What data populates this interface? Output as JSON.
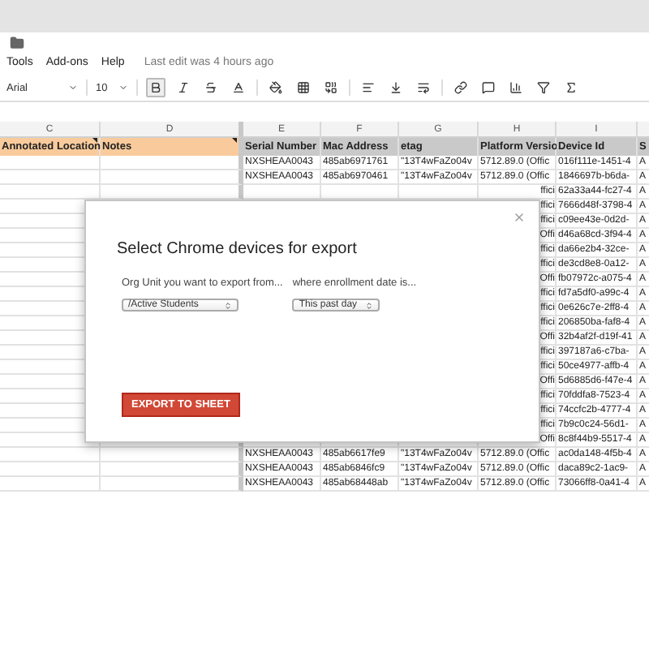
{
  "menu": [
    "Tools",
    "Add-ons",
    "Help"
  ],
  "last_edit": "Last edit was 4 hours ago",
  "toolbar": {
    "font": "Arial",
    "size": "10",
    "bold_pressed": true
  },
  "columns": [
    {
      "letter": "C",
      "header": "Annotated Location",
      "highlight": true
    },
    {
      "letter": "D",
      "header": "Notes",
      "highlight": true
    },
    {
      "letter": "E",
      "header": "Serial Number",
      "highlight": false
    },
    {
      "letter": "F",
      "header": "Mac Address",
      "highlight": false
    },
    {
      "letter": "G",
      "header": "etag",
      "highlight": false
    },
    {
      "letter": "H",
      "header": "Platform Versio",
      "highlight": false
    },
    {
      "letter": "I",
      "header": "Device Id",
      "highlight": false
    },
    {
      "header": "S",
      "highlight": false
    }
  ],
  "rows": [
    {
      "kind": "full",
      "e": "NXSHEAA0043",
      "f": "485ab6971761",
      "g": "\"13T4wFaZo04v",
      "h": "5712.89.0 (Offic",
      "i": "016f111e-1451-4",
      "j": "A"
    },
    {
      "kind": "full",
      "e": "NXSHEAA0043",
      "f": "485ab6970461",
      "g": "\"13T4wFaZo04v",
      "h": "5712.89.0 (Offic",
      "i": "1846697b-b6da-",
      "j": "A"
    },
    {
      "kind": "partial",
      "h": "ffici",
      "i": "62a33a44-fc27-4",
      "j": "A"
    },
    {
      "kind": "covered",
      "h": "ffici",
      "i": "7666d48f-3798-4",
      "j": "A"
    },
    {
      "kind": "covered",
      "h": "ffici",
      "i": "c09ee43e-0d2d-",
      "j": "A"
    },
    {
      "kind": "covered",
      "h": "Offi",
      "i": "d46a68cd-3f94-4",
      "j": "A"
    },
    {
      "kind": "covered",
      "h": "ffici",
      "i": "da66e2b4-32ce-",
      "j": "A"
    },
    {
      "kind": "covered",
      "h": "ffici",
      "i": "de3cd8e8-0a12-",
      "j": "A"
    },
    {
      "kind": "covered",
      "h": "Offi",
      "i": "fb07972c-a075-4",
      "j": "A"
    },
    {
      "kind": "covered",
      "h": "ffici",
      "i": "fd7a5df0-a99c-4",
      "j": "A"
    },
    {
      "kind": "covered",
      "h": "ffici",
      "i": "0e626c7e-2ff8-4",
      "j": "A"
    },
    {
      "kind": "covered",
      "h": "ffici",
      "i": "206850ba-faf8-4",
      "j": "A"
    },
    {
      "kind": "covered",
      "h": "Offi",
      "i": "32b4af2f-d19f-41",
      "j": "A"
    },
    {
      "kind": "covered",
      "h": "ffici",
      "i": "397187a6-c7ba-",
      "j": "A"
    },
    {
      "kind": "covered",
      "h": "ffici",
      "i": "50ce4977-affb-4",
      "j": "A"
    },
    {
      "kind": "covered",
      "h": "Offi",
      "i": "5d6885d6-f47e-4",
      "j": "A"
    },
    {
      "kind": "covered",
      "h": "ffici",
      "i": "70fddfa8-7523-4",
      "j": "A"
    },
    {
      "kind": "covered",
      "h": "ffici",
      "i": "74ccfc2b-4777-4",
      "j": "A"
    },
    {
      "kind": "covered",
      "h": "ffici",
      "i": "7b9c0c24-56d1-",
      "j": "A"
    },
    {
      "kind": "covered",
      "h": "Offi",
      "i": "8c8f44b9-5517-4",
      "j": "A"
    },
    {
      "kind": "full",
      "e": "NXSHEAA0043",
      "f": "485ab6617fe9",
      "g": "\"13T4wFaZo04v",
      "h": "5712.89.0 (Offic",
      "i": "ac0da148-4f5b-4",
      "j": "A"
    },
    {
      "kind": "full",
      "e": "NXSHEAA0043",
      "f": "485ab6846fc9",
      "g": "\"13T4wFaZo04v",
      "h": "5712.89.0 (Offic",
      "i": "daca89c2-1ac9-",
      "j": "A"
    },
    {
      "kind": "full",
      "e": "NXSHEAA0043",
      "f": "485ab68448ab",
      "g": "\"13T4wFaZo04v",
      "h": "5712.89.0 (Offic",
      "i": "73066ff8-0a41-4",
      "j": "A"
    }
  ],
  "dialog": {
    "title": "Select Chrome devices for export",
    "org_label": "Org Unit you want to export from...",
    "date_label": "where enrollment date is...",
    "org_value": "/Active Students",
    "date_value": "This past day",
    "button": "EXPORT TO SHEET"
  }
}
